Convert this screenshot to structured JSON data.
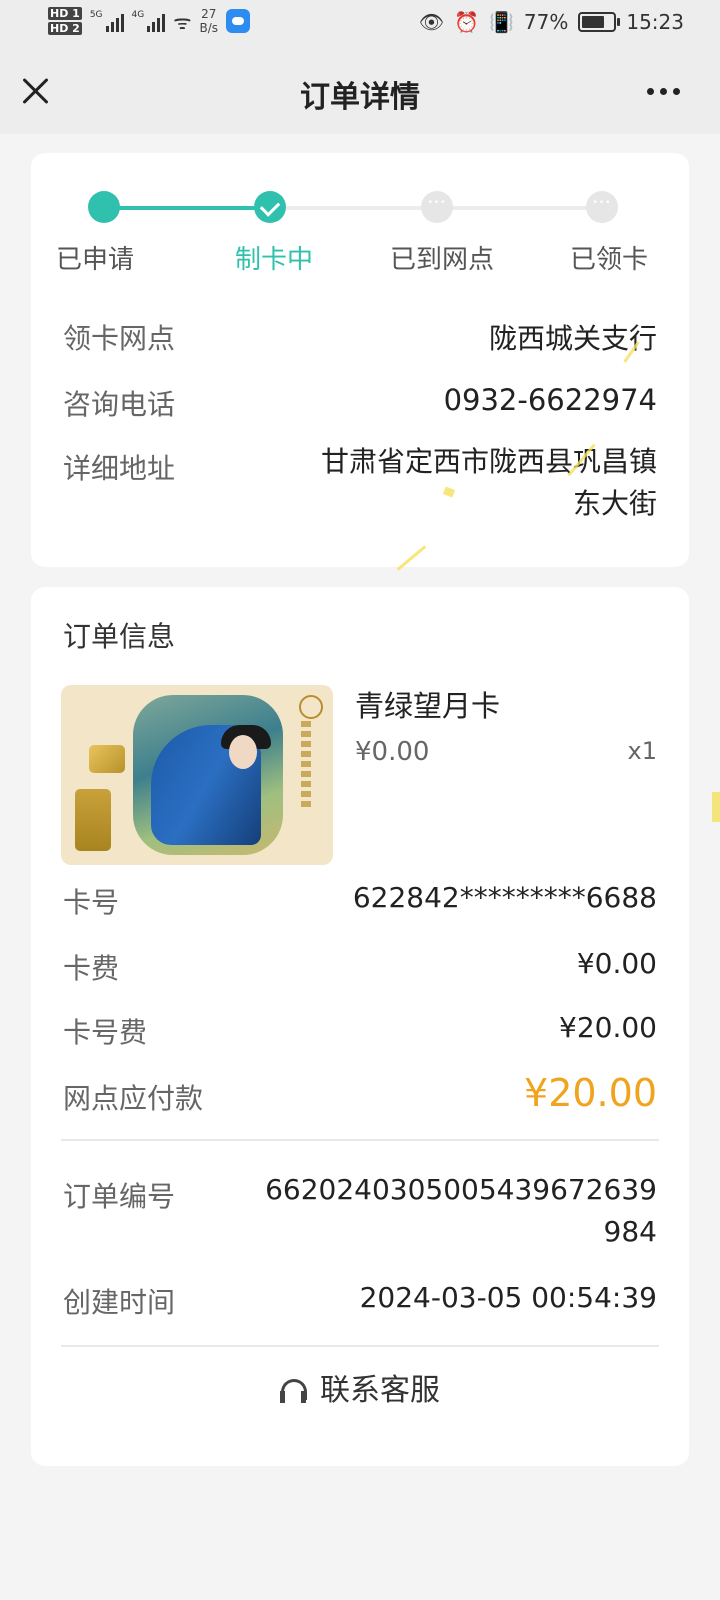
{
  "status_bar": {
    "hd1": "HD 1",
    "hd2": "HD 2",
    "net1": "5G",
    "net2": "4G",
    "speed_value": "27",
    "speed_unit": "B/s",
    "battery": "77%",
    "time": "15:23"
  },
  "nav": {
    "title": "订单详情"
  },
  "steps": [
    {
      "label": "已申请",
      "state": "done"
    },
    {
      "label": "制卡中",
      "state": "current"
    },
    {
      "label": "已到网点",
      "state": "pending"
    },
    {
      "label": "已领卡",
      "state": "pending"
    }
  ],
  "branch": {
    "pickup_label": "领卡网点",
    "pickup_value": "陇西城关支行",
    "phone_label": "咨询电话",
    "phone_value": "0932-6622974",
    "address_label": "详细地址",
    "address_line1": "甘肃省定西市陇西县巩昌镇",
    "address_line2": "东大街"
  },
  "order": {
    "section_title": "订单信息",
    "product_name": "青绿望月卡",
    "product_price": "¥0.00",
    "product_qty": "x1",
    "card_no_label": "卡号",
    "card_no_value": "622842*********6688",
    "card_fee_label": "卡费",
    "card_fee_value": "¥0.00",
    "number_fee_label": "卡号费",
    "number_fee_value": "¥20.00",
    "payable_label": "网点应付款",
    "payable_value": "¥20.00",
    "order_no_label": "订单编号",
    "order_no_line1": "66202403050054396726​39",
    "order_no_line2": "984",
    "created_label": "创建时间",
    "created_value": "2024-03-05 00:54:39",
    "service_label": "联系客服"
  },
  "colors": {
    "accent": "#2fc1ad",
    "price": "#f0a41d"
  }
}
